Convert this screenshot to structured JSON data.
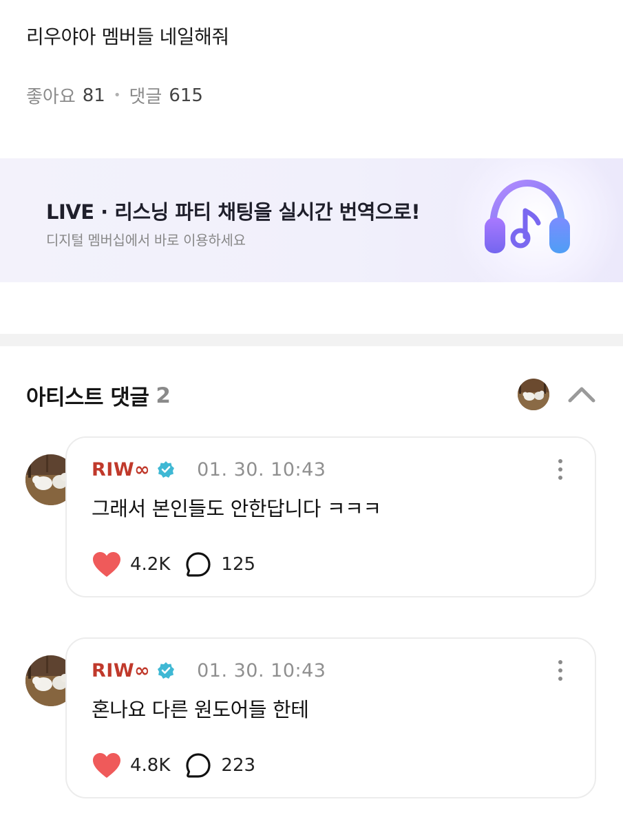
{
  "post": {
    "title": "리우야아 멤버들 네일해줘",
    "likes_label": "좋아요",
    "likes_count": "81",
    "comments_label": "댓글",
    "comments_count": "615"
  },
  "banner": {
    "title": "LIVE · 리스닝 파티 채팅을 실시간 번역으로!",
    "subtitle": "디지털 멤버십에서 바로 이용하세요",
    "icon": "headphones-music-icon"
  },
  "artist_comments": {
    "label": "아티스트 댓글",
    "count": "2",
    "collapse_icon": "chevron-up-icon",
    "comments": [
      {
        "author": "RIW∞",
        "verified_icon": "verified-badge-icon",
        "time": "01. 30. 10:43",
        "text": "그래서 본인들도 안한답니다 ㅋㅋㅋ",
        "likes": "4.2K",
        "replies": "125"
      },
      {
        "author": "RIW∞",
        "verified_icon": "verified-badge-icon",
        "time": "01. 30. 10:43",
        "text": "혼나요 다른 원도어들 한테",
        "likes": "4.8K",
        "replies": "223"
      }
    ]
  },
  "colors": {
    "author": "#c0392b",
    "heart": "#ef5a5a",
    "verified": "#3fb8d4",
    "banner_bg": "#f1f0fb"
  }
}
